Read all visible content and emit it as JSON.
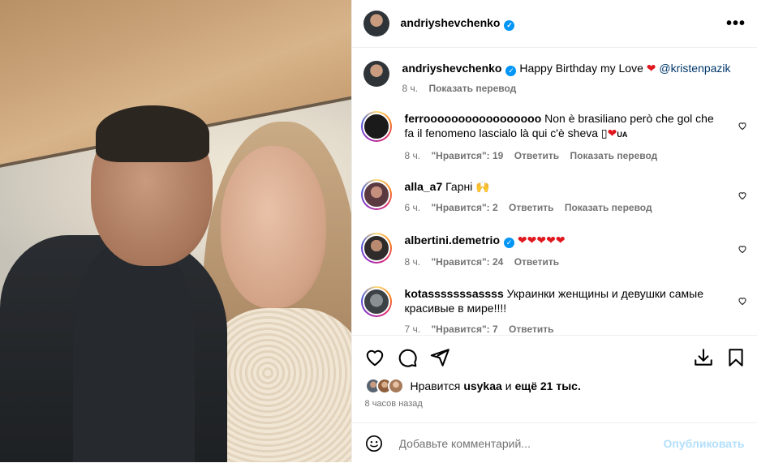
{
  "header": {
    "username": "andriyshevchenko",
    "more_label": "•••"
  },
  "caption": {
    "username": "andriyshevchenko",
    "text": "Happy Birthday my Love",
    "emoji": "❤",
    "mention": "@kristenpazik",
    "time": "8 ч.",
    "translate": "Показать перевод"
  },
  "comments": [
    {
      "username": "ferrooooooooooooooooo",
      "text_line1": "Non è brasiliano però che gol che",
      "text_line2": "fa il fenomeno lascialo là qui c'è sheva",
      "flag_glyph": "▯",
      "heart": "❤",
      "flag_text": "UA",
      "time": "8 ч.",
      "likes": "\"Нравится\": 19",
      "reply": "Ответить",
      "translate": "Показать перевод"
    },
    {
      "username": "alla_a7",
      "text": "Гарні",
      "emoji": "🙌",
      "time": "6 ч.",
      "likes": "\"Нравится\": 2",
      "reply": "Ответить",
      "translate": "Показать перевод"
    },
    {
      "username": "albertini.demetrio",
      "hearts": "❤❤❤❤❤",
      "time": "8 ч.",
      "likes": "\"Нравится\": 24",
      "reply": "Ответить"
    },
    {
      "username": "kotasssssssassss",
      "text_line1": "Украинки женщины и девушки самые",
      "text_line2": "красивые в мире!!!!",
      "time": "7 ч.",
      "likes": "\"Нравится\": 7",
      "reply": "Ответить"
    }
  ],
  "footer": {
    "likes_prefix": "Нравится",
    "likes_user": "usykaa",
    "likes_and": "и",
    "likes_count": "ещё 21 тыс.",
    "time_ago": "8 часов назад",
    "comment_placeholder": "Добавьте комментарий...",
    "post_label": "Опубликовать"
  },
  "colors": {
    "verified": "#0095f6",
    "heart": "#e0181e",
    "post_disabled": "#b2dffc",
    "meta_gray": "#737373"
  },
  "icons": [
    "like-icon",
    "comment-icon",
    "share-icon",
    "save-icon",
    "bookmark-icon",
    "emoji-icon",
    "verified-icon",
    "more-icon"
  ]
}
